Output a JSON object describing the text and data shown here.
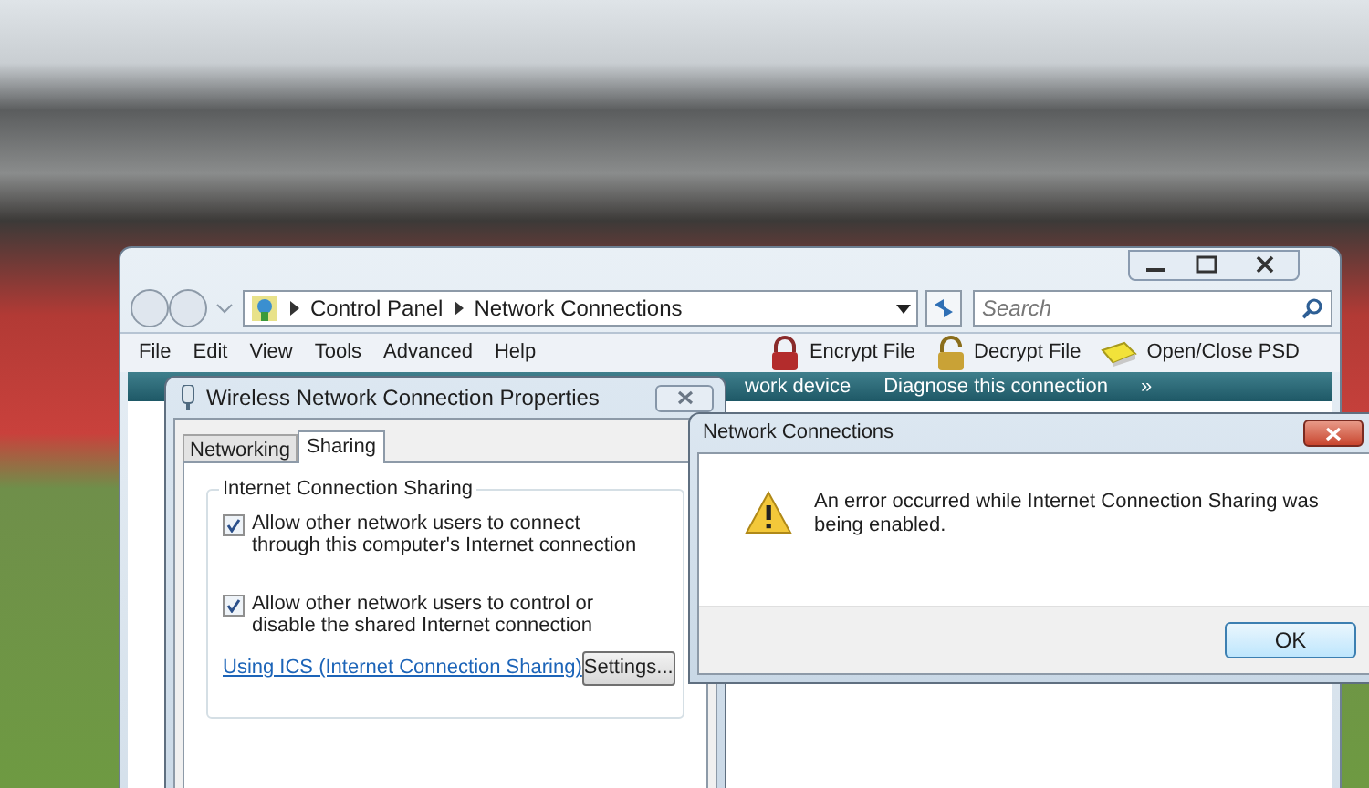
{
  "explorer": {
    "address_path": [
      "Control Panel",
      "Network Connections"
    ],
    "search": {
      "placeholder": "Search"
    },
    "menu": [
      "File",
      "Edit",
      "View",
      "Tools",
      "Advanced",
      "Help"
    ],
    "toolbar": [
      {
        "label": "Encrypt File",
        "kind": "lock"
      },
      {
        "label": "Decrypt File",
        "kind": "unlock"
      },
      {
        "label": "Open/Close PSD",
        "kind": "drive"
      }
    ],
    "command_bar": [
      "work device",
      "Diagnose this connection",
      "»"
    ]
  },
  "properties_dialog": {
    "title": "Wireless Network Connection Properties",
    "tabs": [
      {
        "label": "Networking",
        "selected": false
      },
      {
        "label": "Sharing",
        "selected": true
      }
    ],
    "group_title": "Internet Connection Sharing",
    "options": [
      {
        "label": "Allow other network users to connect through this computer's Internet connection",
        "checked": true
      },
      {
        "label": "Allow other network users to control or disable the shared Internet connection",
        "checked": true
      }
    ],
    "link": "Using ICS (Internet Connection Sharing)",
    "settings_button": "Settings..."
  },
  "error_dialog": {
    "title": "Network Connections",
    "message": "An error occurred while Internet Connection Sharing was being enabled.",
    "button": "OK"
  }
}
